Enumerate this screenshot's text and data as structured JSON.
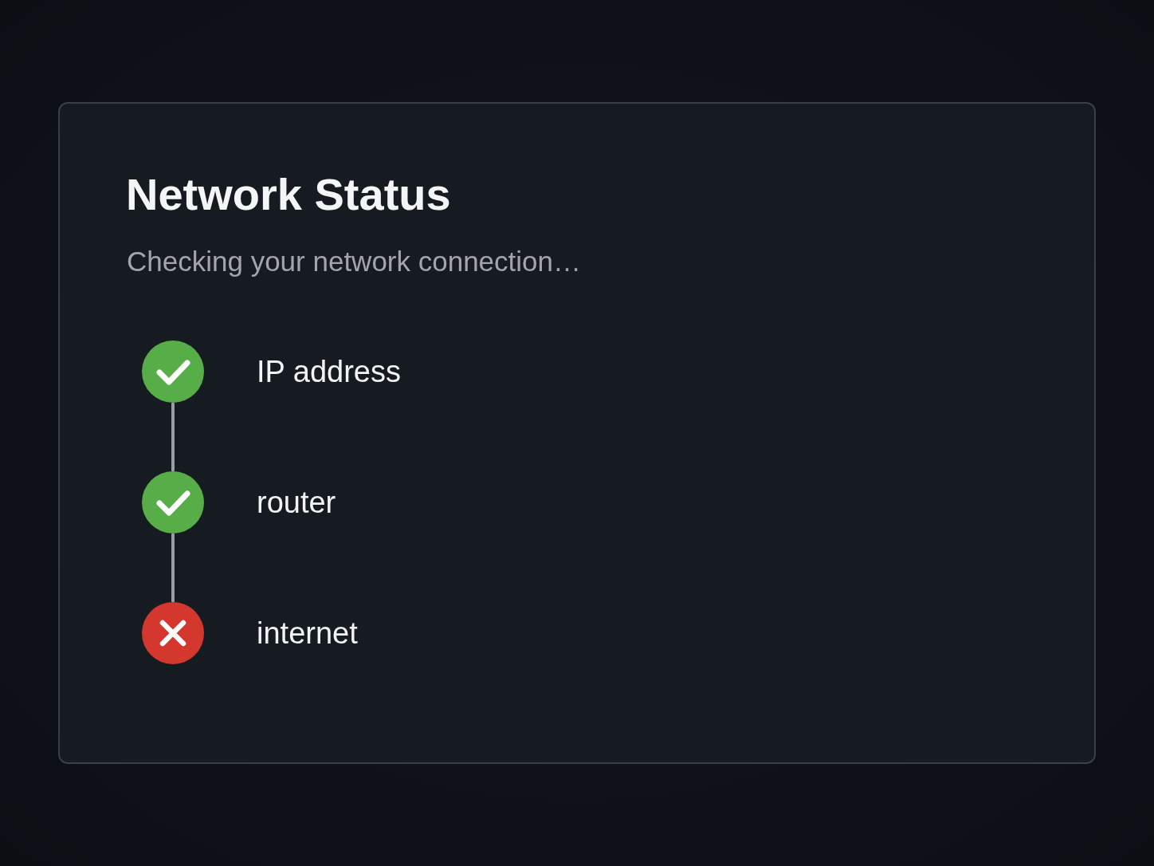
{
  "card": {
    "title": "Network Status",
    "subtitle": "Checking your network connection…",
    "steps": [
      {
        "label": "IP address",
        "passed": true
      },
      {
        "label": "router",
        "passed": true
      },
      {
        "label": "internet",
        "passed": false
      }
    ]
  }
}
